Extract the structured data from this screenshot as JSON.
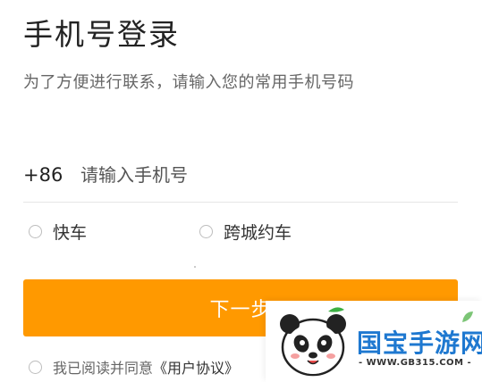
{
  "page": {
    "title": "手机号登录",
    "subtitle": "为了方便进行联系，请输入您的常用手机号码"
  },
  "phone": {
    "country_code": "+86",
    "placeholder": "请输入手机号",
    "value": ""
  },
  "ride_options": [
    {
      "label": "快车",
      "selected": false
    },
    {
      "label": "跨城约车",
      "selected": false
    }
  ],
  "next_button": {
    "label": "下一步",
    "color": "#ff9900"
  },
  "agreement": {
    "text": "我已阅读并同意",
    "link": "《用户协议》",
    "checked": false
  },
  "watermark": {
    "brand": "国宝手游网",
    "url": "- WWW.GB315.COM -"
  }
}
